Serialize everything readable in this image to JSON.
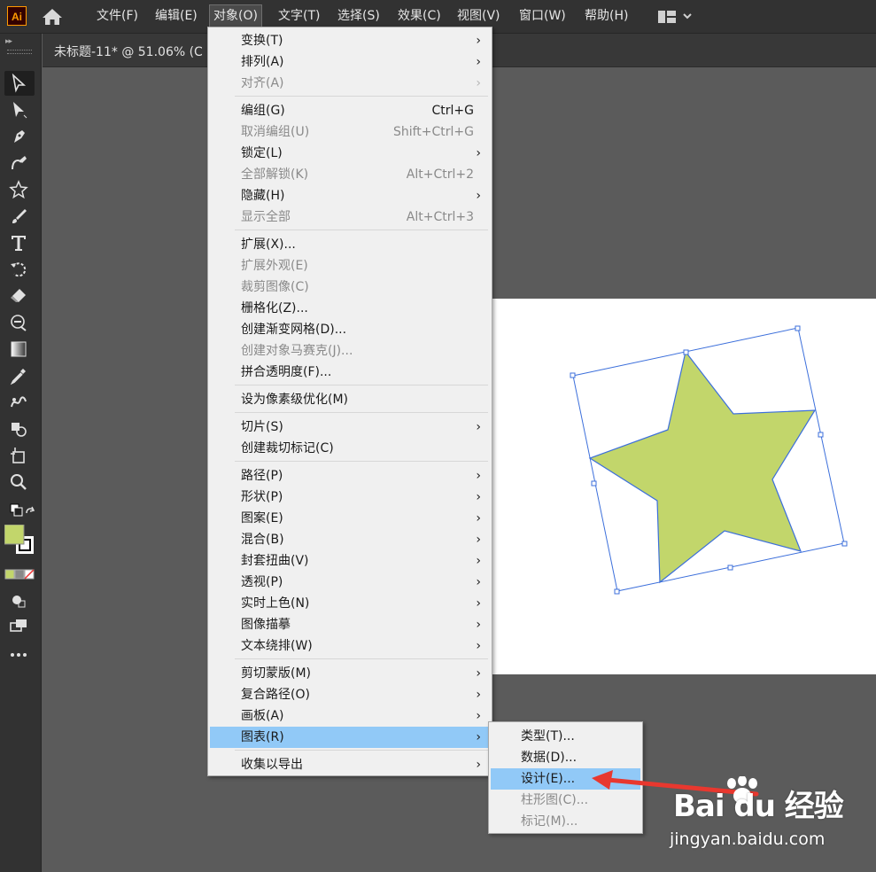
{
  "app": {
    "logo_text": "Ai"
  },
  "menubar": {
    "items": [
      {
        "label": "文件(F)"
      },
      {
        "label": "编辑(E)"
      },
      {
        "label": "对象(O)"
      },
      {
        "label": "文字(T)"
      },
      {
        "label": "选择(S)"
      },
      {
        "label": "效果(C)"
      },
      {
        "label": "视图(V)"
      },
      {
        "label": "窗口(W)"
      },
      {
        "label": "帮助(H)"
      }
    ],
    "active_index": 2
  },
  "document": {
    "tab_title": "未标题-11* @ 51.06% (C"
  },
  "object_menu": {
    "items": [
      {
        "label": "变换(T)",
        "shortcut": "",
        "submenu": true,
        "disabled": false
      },
      {
        "label": "排列(A)",
        "shortcut": "",
        "submenu": true,
        "disabled": false
      },
      {
        "label": "对齐(A)",
        "shortcut": "",
        "submenu": true,
        "disabled": true
      },
      {
        "label": "编组(G)",
        "shortcut": "Ctrl+G",
        "submenu": false,
        "disabled": false
      },
      {
        "label": "取消编组(U)",
        "shortcut": "Shift+Ctrl+G",
        "submenu": false,
        "disabled": true
      },
      {
        "label": "锁定(L)",
        "shortcut": "",
        "submenu": true,
        "disabled": false
      },
      {
        "label": "全部解锁(K)",
        "shortcut": "Alt+Ctrl+2",
        "submenu": false,
        "disabled": true
      },
      {
        "label": "隐藏(H)",
        "shortcut": "",
        "submenu": true,
        "disabled": false
      },
      {
        "label": "显示全部",
        "shortcut": "Alt+Ctrl+3",
        "submenu": false,
        "disabled": true
      },
      {
        "label": "扩展(X)...",
        "shortcut": "",
        "submenu": false,
        "disabled": false
      },
      {
        "label": "扩展外观(E)",
        "shortcut": "",
        "submenu": false,
        "disabled": true
      },
      {
        "label": "裁剪图像(C)",
        "shortcut": "",
        "submenu": false,
        "disabled": true
      },
      {
        "label": "栅格化(Z)...",
        "shortcut": "",
        "submenu": false,
        "disabled": false
      },
      {
        "label": "创建渐变网格(D)...",
        "shortcut": "",
        "submenu": false,
        "disabled": false
      },
      {
        "label": "创建对象马赛克(J)...",
        "shortcut": "",
        "submenu": false,
        "disabled": true
      },
      {
        "label": "拼合透明度(F)...",
        "shortcut": "",
        "submenu": false,
        "disabled": false
      },
      {
        "label": "设为像素级优化(M)",
        "shortcut": "",
        "submenu": false,
        "disabled": false
      },
      {
        "label": "切片(S)",
        "shortcut": "",
        "submenu": true,
        "disabled": false
      },
      {
        "label": "创建裁切标记(C)",
        "shortcut": "",
        "submenu": false,
        "disabled": false
      },
      {
        "label": "路径(P)",
        "shortcut": "",
        "submenu": true,
        "disabled": false
      },
      {
        "label": "形状(P)",
        "shortcut": "",
        "submenu": true,
        "disabled": false
      },
      {
        "label": "图案(E)",
        "shortcut": "",
        "submenu": true,
        "disabled": false
      },
      {
        "label": "混合(B)",
        "shortcut": "",
        "submenu": true,
        "disabled": false
      },
      {
        "label": "封套扭曲(V)",
        "shortcut": "",
        "submenu": true,
        "disabled": false
      },
      {
        "label": "透视(P)",
        "shortcut": "",
        "submenu": true,
        "disabled": false
      },
      {
        "label": "实时上色(N)",
        "shortcut": "",
        "submenu": true,
        "disabled": false
      },
      {
        "label": "图像描摹",
        "shortcut": "",
        "submenu": true,
        "disabled": false
      },
      {
        "label": "文本绕排(W)",
        "shortcut": "",
        "submenu": true,
        "disabled": false
      },
      {
        "label": "剪切蒙版(M)",
        "shortcut": "",
        "submenu": true,
        "disabled": false
      },
      {
        "label": "复合路径(O)",
        "shortcut": "",
        "submenu": true,
        "disabled": false
      },
      {
        "label": "画板(A)",
        "shortcut": "",
        "submenu": true,
        "disabled": false
      },
      {
        "label": "图表(R)",
        "shortcut": "",
        "submenu": true,
        "disabled": false,
        "highlighted": true
      },
      {
        "label": "收集以导出",
        "shortcut": "",
        "submenu": true,
        "disabled": false
      }
    ],
    "arrow_glyph": "›"
  },
  "graph_submenu": {
    "items": [
      {
        "label": "类型(T)...",
        "disabled": false
      },
      {
        "label": "数据(D)...",
        "disabled": false
      },
      {
        "label": "设计(E)...",
        "disabled": false,
        "highlighted": true
      },
      {
        "label": "柱形图(C)...",
        "disabled": true
      },
      {
        "label": "标记(M)...",
        "disabled": true
      }
    ]
  },
  "colors": {
    "fill_swatch": "#c2d66b",
    "star_fill": "#c2d66b",
    "selection": "#3c6fdb",
    "menu_highlight": "#91c9f7",
    "annotation_arrow": "#e8382f"
  },
  "watermark": {
    "logo": "Bai du 经验",
    "url": "jingyan.baidu.com"
  }
}
